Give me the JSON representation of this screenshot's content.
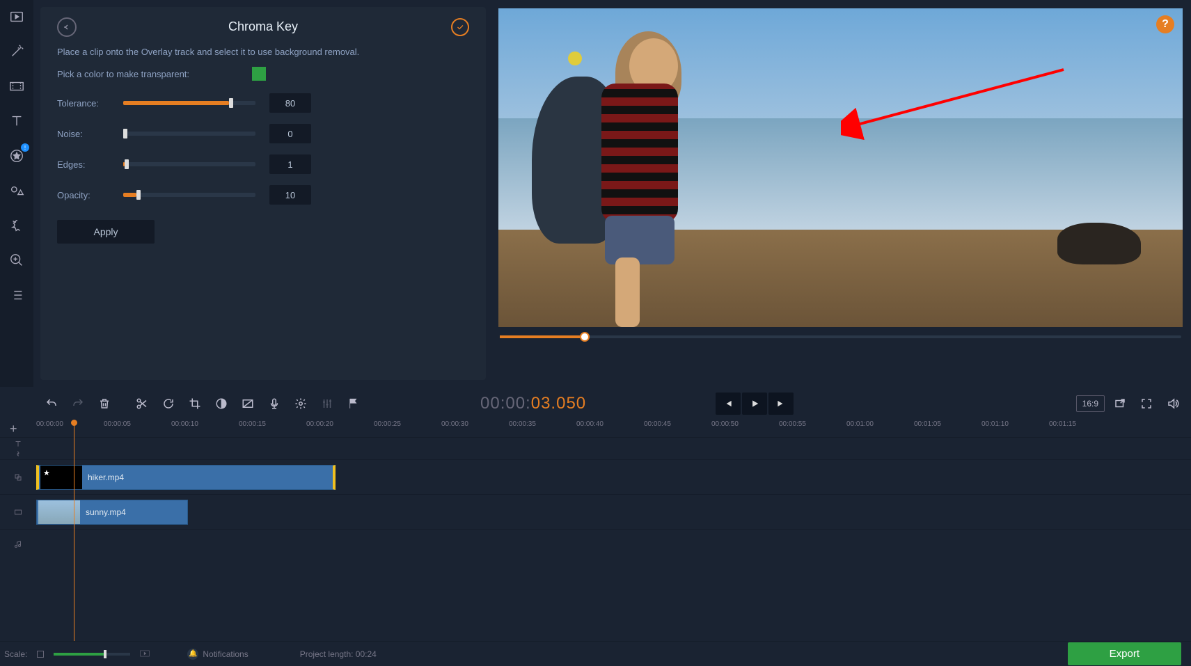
{
  "panel": {
    "title": "Chroma Key",
    "hint": "Place a clip onto the Overlay track and select it to use background removal.",
    "pick_label": "Pick a color to make transparent:",
    "color_hex": "#2ea043",
    "sliders": [
      {
        "label": "Tolerance:",
        "value": "80",
        "percent": 80
      },
      {
        "label": "Noise:",
        "value": "0",
        "percent": 0
      },
      {
        "label": "Edges:",
        "value": "1",
        "percent": 1
      },
      {
        "label": "Opacity:",
        "value": "10",
        "percent": 10
      }
    ],
    "apply": "Apply"
  },
  "timecode": {
    "gray": "00:00:",
    "orange": "03.050"
  },
  "aspect": "16:9",
  "ruler": [
    "00:00:00",
    "00:00:05",
    "00:00:10",
    "00:00:15",
    "00:00:20",
    "00:00:25",
    "00:00:30",
    "00:00:35",
    "00:00:40",
    "00:00:45",
    "00:00:50",
    "00:00:55",
    "00:01:00",
    "00:01:05",
    "00:01:10",
    "00:01:15"
  ],
  "clips": {
    "overlay": "hiker.mp4",
    "video": "sunny.mp4"
  },
  "bottom": {
    "scale": "Scale:",
    "notifications": "Notifications",
    "project_length_label": "Project length:",
    "project_length_value": "00:24",
    "export": "Export"
  },
  "help": "?"
}
